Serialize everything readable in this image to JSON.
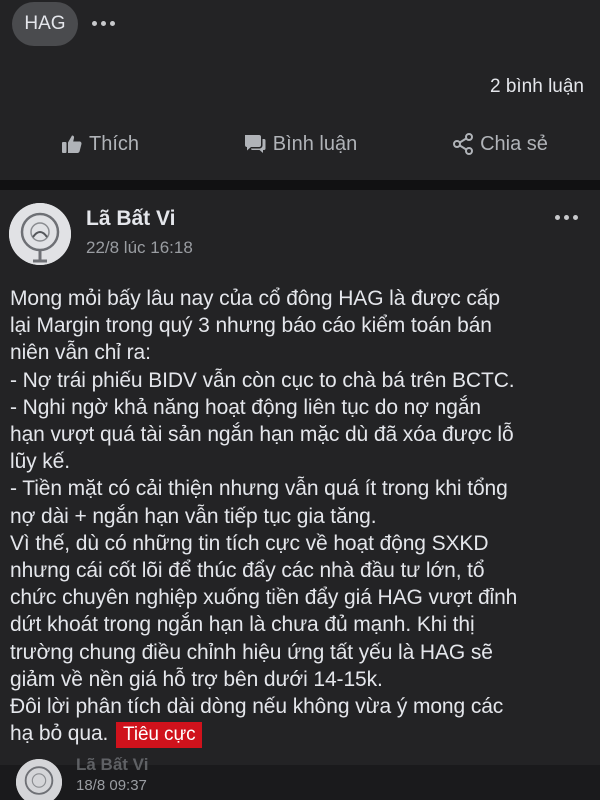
{
  "previous_post": {
    "tag": "HAG",
    "comment_count": "2 bình luận",
    "actions": {
      "like": "Thích",
      "comment": "Bình luận",
      "share": "Chia sẻ"
    }
  },
  "comment": {
    "author": "Lã Bất Vi",
    "timestamp": "22/8 lúc 16:18",
    "lines": [
      "Mong mỏi bấy lâu nay của cổ đông HAG là được cấp",
      "lại Margin trong quý 3 nhưng báo cáo kiểm toán bán",
      "niên vẫn chỉ ra:",
      "- Nợ trái phiếu BIDV vẫn còn cục to chà bá trên BCTC.",
      "- Nghi ngờ khả năng hoạt động liên tục do nợ ngắn",
      "hạn vượt quá tài sản ngắn hạn mặc dù đã xóa được lỗ",
      "lũy kế.",
      "- Tiền mặt có cải thiện nhưng vẫn quá ít trong khi tổng",
      "nợ dài + ngắn hạn vẫn tiếp tục gia tăng.",
      "Vì thế, dù có những tin tích cực về hoạt động SXKD",
      "nhưng cái cốt lõi để thúc đẩy các nhà đầu tư lớn, tổ",
      "chức chuyên nghiệp xuống tiền đẩy giá HAG vượt đỉnh",
      "dứt khoát trong ngắn hạn là chưa đủ mạnh. Khi thị",
      "trường chung điều chỉnh hiệu ứng tất yếu là HAG sẽ",
      "giảm về nền giá hỗ trợ bên dưới 14-15k.",
      "Đôi lời phân tích dài dòng nếu không vừa ý mong các",
      "hạ bỏ qua."
    ],
    "sentiment_badge": "Tiêu cực",
    "badge_color": "#d0121c"
  },
  "next_comment": {
    "author": "Lã Bất Vi",
    "timestamp": "18/8 09:37"
  }
}
